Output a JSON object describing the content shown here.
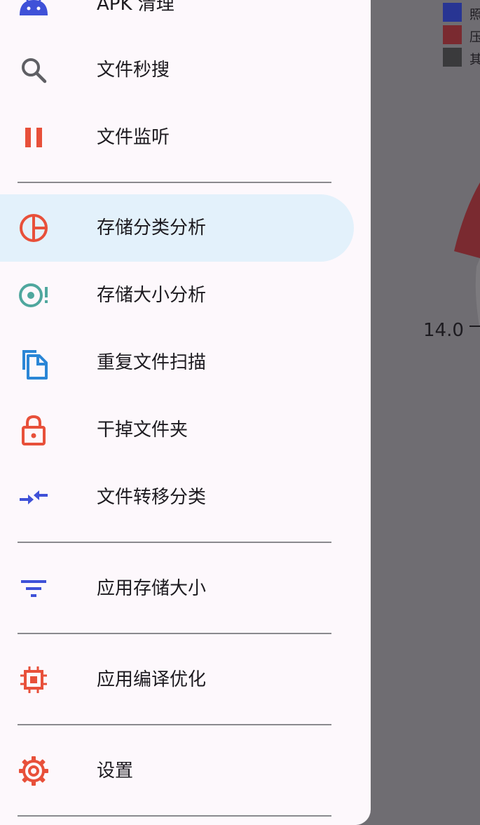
{
  "drawer": {
    "items": [
      {
        "label": "APK 清理",
        "icon": "android-icon",
        "color": "#3f51d8"
      },
      {
        "label": "文件秒搜",
        "icon": "search-icon",
        "color": "#5f5f64"
      },
      {
        "label": "文件监听",
        "icon": "pause-icon",
        "color": "#e8503a"
      },
      {
        "label": "存储分类分析",
        "icon": "pie-chart-icon",
        "color": "#e8503a",
        "selected": true
      },
      {
        "label": "存储大小分析",
        "icon": "target-alert-icon",
        "color": "#4fa79e"
      },
      {
        "label": "重复文件扫描",
        "icon": "copy-files-icon",
        "color": "#2a86d6"
      },
      {
        "label": "干掉文件夹",
        "icon": "lock-icon",
        "color": "#e8503a"
      },
      {
        "label": "文件转移分类",
        "icon": "compare-arrows-icon",
        "color": "#3f51d8"
      },
      {
        "label": "应用存储大小",
        "icon": "filter-icon",
        "color": "#3f51d8"
      },
      {
        "label": "应用编译优化",
        "icon": "chip-icon",
        "color": "#e8503a"
      },
      {
        "label": "设置",
        "icon": "gear-icon",
        "color": "#e8503a"
      }
    ]
  },
  "background": {
    "legend": [
      {
        "label": "照",
        "color": "#283593"
      },
      {
        "label": "压",
        "color": "#7a2a30"
      },
      {
        "label": "其",
        "color": "#3a3a3c"
      }
    ],
    "chart_label": "14.0",
    "scrim_color": "#6f6d72"
  }
}
